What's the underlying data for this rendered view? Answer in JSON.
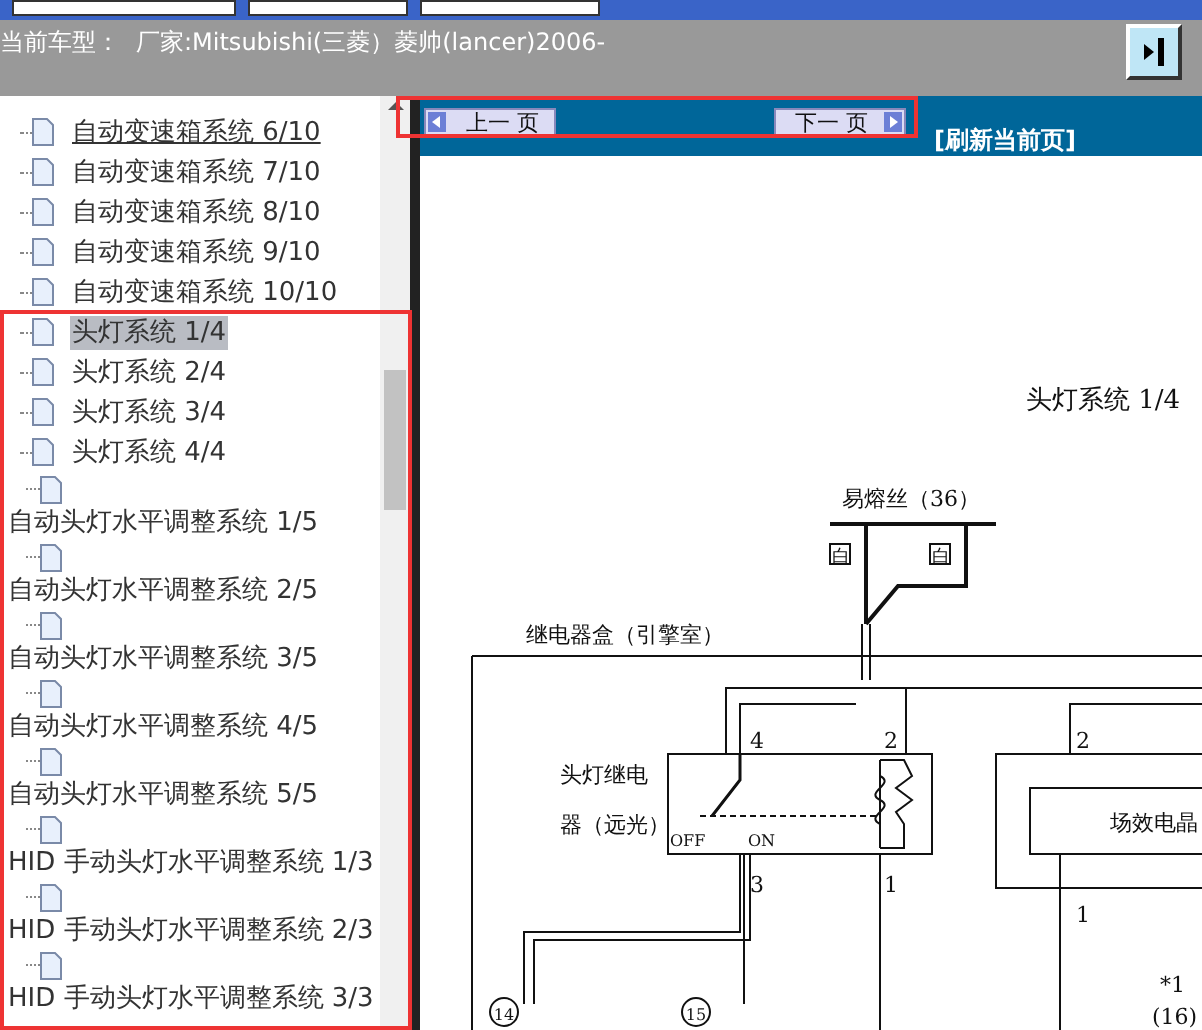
{
  "header": {
    "vehicle_label": "当前车型：",
    "vehicle": "厂家:Mitsubishi(三菱）菱帅(lancer)2006-"
  },
  "tree": {
    "items": [
      {
        "kind": "inline",
        "label": "自动变速箱系统 6/10",
        "selected": false,
        "hovered": true
      },
      {
        "kind": "inline",
        "label": "自动变速箱系统 7/10",
        "selected": false,
        "hovered": false
      },
      {
        "kind": "inline",
        "label": "自动变速箱系统 8/10",
        "selected": false,
        "hovered": false
      },
      {
        "kind": "inline",
        "label": "自动变速箱系统 9/10",
        "selected": false,
        "hovered": false
      },
      {
        "kind": "inline",
        "label": "自动变速箱系统 10/10",
        "selected": false,
        "hovered": false
      },
      {
        "kind": "inline",
        "label": "头灯系统 1/4",
        "selected": true,
        "hovered": false
      },
      {
        "kind": "inline",
        "label": "头灯系统 2/4",
        "selected": false,
        "hovered": false
      },
      {
        "kind": "inline",
        "label": "头灯系统 3/4",
        "selected": false,
        "hovered": false
      },
      {
        "kind": "inline",
        "label": "头灯系统 4/4",
        "selected": false,
        "hovered": false
      },
      {
        "kind": "wrapped",
        "label": "自动头灯水平调整系统 1/5",
        "selected": false,
        "hovered": false
      },
      {
        "kind": "wrapped",
        "label": "自动头灯水平调整系统 2/5",
        "selected": false,
        "hovered": false
      },
      {
        "kind": "wrapped",
        "label": "自动头灯水平调整系统 3/5",
        "selected": false,
        "hovered": false
      },
      {
        "kind": "wrapped",
        "label": "自动头灯水平调整系统 4/5",
        "selected": false,
        "hovered": false
      },
      {
        "kind": "wrapped",
        "label": "自动头灯水平调整系统 5/5",
        "selected": false,
        "hovered": false
      },
      {
        "kind": "wrapped",
        "label": "HID 手动头灯水平调整系统 1/3",
        "selected": false,
        "hovered": false
      },
      {
        "kind": "wrapped",
        "label": "HID 手动头灯水平调整系统 2/3",
        "selected": false,
        "hovered": false
      },
      {
        "kind": "wrapped",
        "label": "HID 手动头灯水平调整系统 3/3",
        "selected": false,
        "hovered": false
      }
    ]
  },
  "nav": {
    "prev": "上一 页",
    "next": "下一 页",
    "refresh": "[刷新当前页]"
  },
  "diagram": {
    "title": "头灯系统 1/4",
    "fuse_label": "易熔丝（36）",
    "wire_colors": [
      "白",
      "白"
    ],
    "relay_box_label": "继电器盒（引擎室）",
    "relay_label": [
      "头灯继电",
      "器（远光）"
    ],
    "switch_states": [
      "OFF",
      "ON"
    ],
    "pins": [
      "4",
      "2",
      "3",
      "1",
      "2",
      "1"
    ],
    "module_label": "场效电晶",
    "note": "*1",
    "connectors": [
      "14",
      "15",
      "(16)"
    ]
  }
}
